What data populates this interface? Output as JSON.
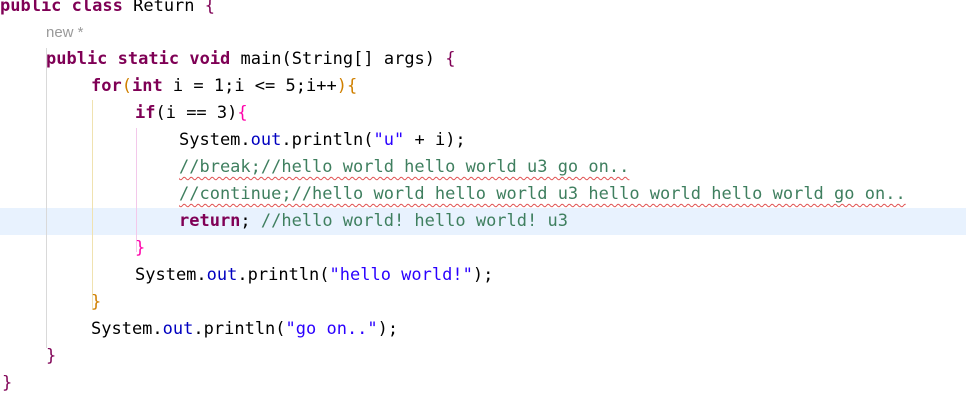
{
  "editor": {
    "lines": {
      "l1": {
        "kw1": "public",
        "kw2": "class",
        "name": "Return",
        "brace": "{"
      },
      "l2": {
        "hint": "new *"
      },
      "l3": {
        "kw1": "public",
        "kw2": "static",
        "kw3": "void",
        "method": "main",
        "params": "(String[] args)",
        "brace": "{"
      },
      "l4": {
        "kw": "for",
        "paren": "(",
        "kw2": "int",
        "expr": " i = 1;i <= 5;i++",
        "close": ")",
        "brace": "{"
      },
      "l5": {
        "kw": "if",
        "expr": "(i == 3)",
        "brace": "{"
      },
      "l6": {
        "cls": "System",
        "dot1": ".",
        "field": "out",
        "dot2": ".",
        "call": "println(",
        "str": "\"u\"",
        "rest": " + i);"
      },
      "l7": {
        "comment": "//break;//hello world hello world u3 go on.."
      },
      "l8": {
        "comment": "//continue;//hello world hello world u3 hello world hello world go on.."
      },
      "l9": {
        "kw": "return",
        "semi": "; ",
        "comment": "//hello world! hello world! u3"
      },
      "l10": {
        "brace": "}"
      },
      "l11": {
        "cls": "System",
        "dot1": ".",
        "field": "out",
        "dot2": ".",
        "call": "println(",
        "str": "\"hello world!\"",
        "rest": ");"
      },
      "l12": {
        "brace": "}"
      },
      "l13": {
        "cls": "System",
        "dot1": ".",
        "field": "out",
        "dot2": ".",
        "call": "println(",
        "str": "\"go on..\"",
        "rest": ");"
      },
      "l14": {
        "brace": "}"
      },
      "l15": {
        "brace": "}"
      }
    }
  }
}
